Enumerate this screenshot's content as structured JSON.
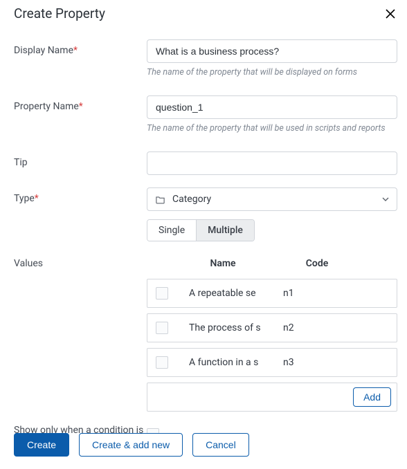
{
  "dialog": {
    "title": "Create Property"
  },
  "labels": {
    "displayName": "Display Name",
    "propertyName": "Property Name",
    "tip": "Tip",
    "type": "Type",
    "values": "Values",
    "condition": "Show only when a condition is met"
  },
  "fields": {
    "displayName": {
      "value": "What is a business process?"
    },
    "displayNameHelper": "The name of the property that will be displayed on forms",
    "propertyName": {
      "value": "question_1"
    },
    "propertyNameHelper": "The name of the property that will be used in scripts and reports",
    "tip": {
      "value": ""
    },
    "type": {
      "value": "Category"
    },
    "mode": {
      "single": "Single",
      "multiple": "Multiple"
    }
  },
  "valuesTable": {
    "headers": {
      "name": "Name",
      "code": "Code"
    },
    "rows": [
      {
        "name": "A repeatable se",
        "code": "n1"
      },
      {
        "name": "The process of s",
        "code": "n2"
      },
      {
        "name": "A function in a s",
        "code": "n3"
      }
    ],
    "addLabel": "Add"
  },
  "footer": {
    "create": "Create",
    "createAddNew": "Create & add new",
    "cancel": "Cancel"
  }
}
